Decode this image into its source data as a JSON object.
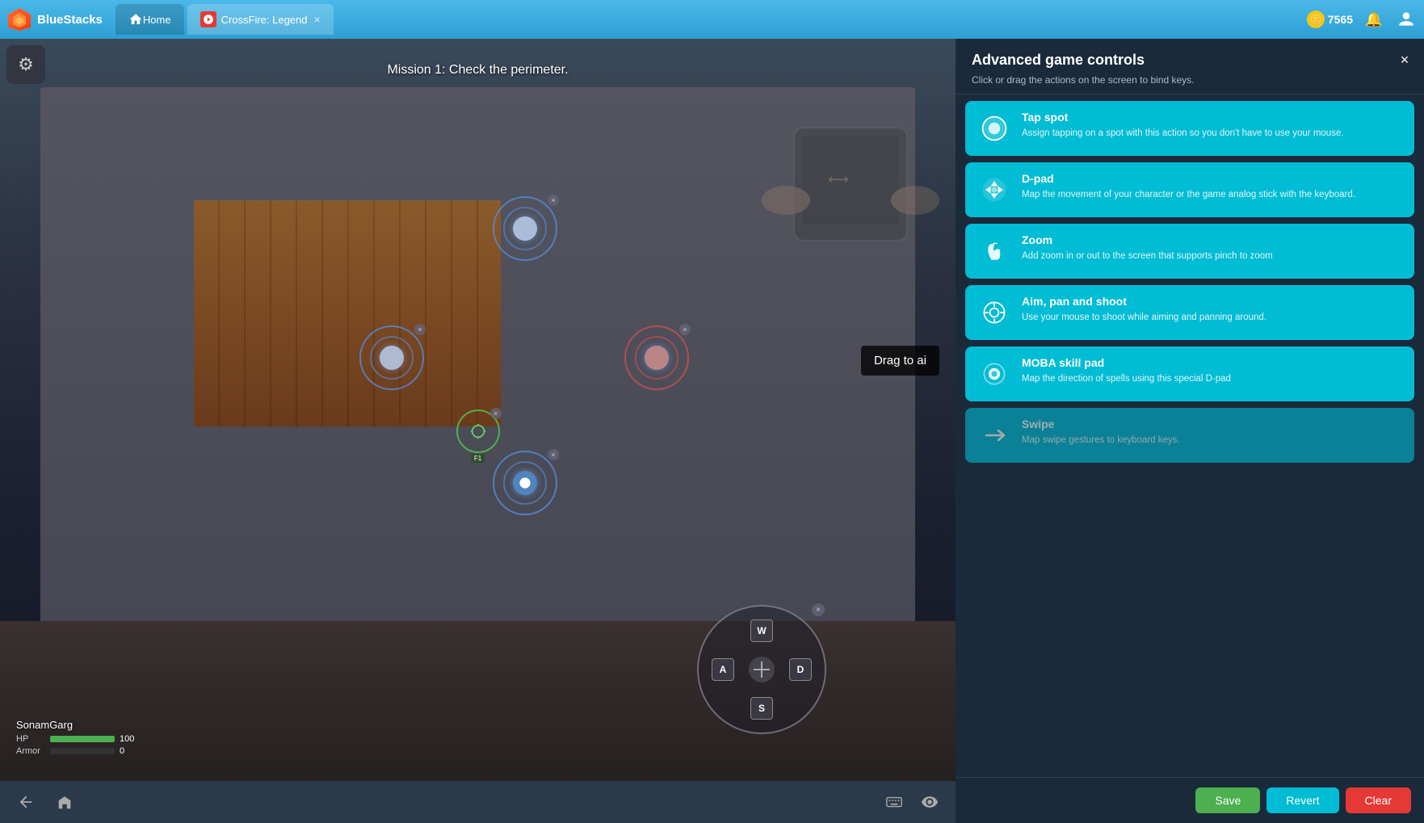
{
  "app": {
    "brand": "BlueStacks",
    "close_label": "×"
  },
  "tabs": [
    {
      "id": "home",
      "label": "Home",
      "active": false
    },
    {
      "id": "crossfire",
      "label": "CrossFire: Legend",
      "active": true
    }
  ],
  "header_right": {
    "coins": "7565"
  },
  "game": {
    "mission_text": "Mission 1: Check the perimeter.",
    "player_name": "SonamGarg",
    "hp_label": "HP",
    "hp_value": "100",
    "armor_label": "Armor",
    "armor_value": "0",
    "drag_to_aim": "Drag to ai"
  },
  "panel": {
    "title": "Advanced game controls",
    "subtitle": "Click or drag the actions on the screen to bind keys.",
    "controls": [
      {
        "id": "tap-spot",
        "title": "Tap spot",
        "description": "Assign tapping on a spot with this action so you don't have to use your mouse.",
        "icon": "tap"
      },
      {
        "id": "d-pad",
        "title": "D-pad",
        "description": "Map the movement of your character or the game analog stick with the keyboard.",
        "icon": "dpad"
      },
      {
        "id": "zoom",
        "title": "Zoom",
        "description": "Add zoom in or out to the screen that supports pinch to zoom",
        "icon": "zoom"
      },
      {
        "id": "aim-pan-shoot",
        "title": "Aim, pan and shoot",
        "description": "Use your mouse to shoot while aiming and panning around.",
        "icon": "aim"
      },
      {
        "id": "moba-skill-pad",
        "title": "MOBA skill pad",
        "description": "Map the direction of spells using this special D-pad",
        "icon": "moba"
      },
      {
        "id": "swipe",
        "title": "Swipe",
        "description": "Map swipe gestures to keyboard keys.",
        "icon": "swipe"
      }
    ],
    "actions": {
      "save": "Save",
      "revert": "Revert",
      "clear": "Clear"
    }
  },
  "bottom_bar": {
    "back_label": "back",
    "home_label": "home",
    "keyboard_label": "keyboard",
    "eye_label": "eye"
  }
}
